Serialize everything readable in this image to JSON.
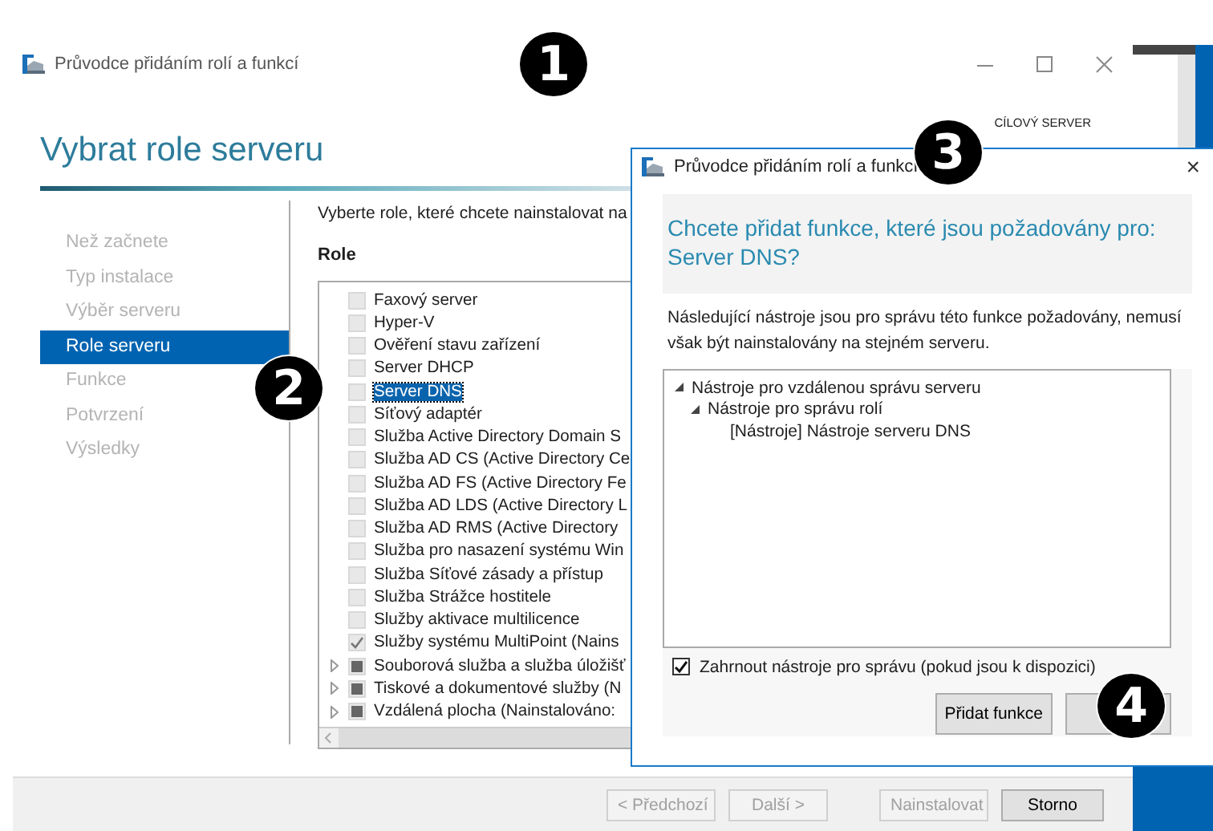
{
  "main_window": {
    "title": "Průvodce přidáním rolí a funkcí",
    "heading": "Vybrat role serveru",
    "target_label": "CÍLOVÝ SERVER",
    "sidebar": [
      {
        "label": "Než začnete",
        "selected": false
      },
      {
        "label": "Typ instalace",
        "selected": false
      },
      {
        "label": "Výběr serveru",
        "selected": false
      },
      {
        "label": "Role serveru",
        "selected": true
      },
      {
        "label": "Funkce",
        "selected": false
      },
      {
        "label": "Potvrzení",
        "selected": false
      },
      {
        "label": "Výsledky",
        "selected": false
      }
    ],
    "instruction": "Vyberte role, které chcete nainstalovat na",
    "roles_label": "Role",
    "roles": [
      {
        "label": "Faxový server",
        "checked": false,
        "partial": false,
        "expandable": false,
        "selected": false
      },
      {
        "label": "Hyper-V",
        "checked": false,
        "partial": false,
        "expandable": false,
        "selected": false
      },
      {
        "label": "Ověření stavu zařízení",
        "checked": false,
        "partial": false,
        "expandable": false,
        "selected": false
      },
      {
        "label": "Server DHCP",
        "checked": false,
        "partial": false,
        "expandable": false,
        "selected": false
      },
      {
        "label": "Server DNS",
        "checked": false,
        "partial": false,
        "expandable": false,
        "selected": true
      },
      {
        "label": "Síťový adaptér",
        "checked": false,
        "partial": false,
        "expandable": false,
        "selected": false
      },
      {
        "label": "Služba Active Directory Domain S",
        "checked": false,
        "partial": false,
        "expandable": false,
        "selected": false
      },
      {
        "label": "Služba AD CS (Active Directory Ce",
        "checked": false,
        "partial": false,
        "expandable": false,
        "selected": false
      },
      {
        "label": "Služba AD FS (Active Directory Fe",
        "checked": false,
        "partial": false,
        "expandable": false,
        "selected": false
      },
      {
        "label": "Služba AD LDS (Active Directory L",
        "checked": false,
        "partial": false,
        "expandable": false,
        "selected": false
      },
      {
        "label": "Služba AD RMS (Active Directory",
        "checked": false,
        "partial": false,
        "expandable": false,
        "selected": false
      },
      {
        "label": "Služba pro nasazení systému Win",
        "checked": false,
        "partial": false,
        "expandable": false,
        "selected": false
      },
      {
        "label": "Služba Síťové zásady a přístup",
        "checked": false,
        "partial": false,
        "expandable": false,
        "selected": false
      },
      {
        "label": "Služba Strážce hostitele",
        "checked": false,
        "partial": false,
        "expandable": false,
        "selected": false
      },
      {
        "label": "Služby aktivace multilicence",
        "checked": false,
        "partial": false,
        "expandable": false,
        "selected": false
      },
      {
        "label": "Služby systému MultiPoint (Nains",
        "checked": true,
        "partial": false,
        "expandable": false,
        "selected": false
      },
      {
        "label": "Souborová služba a služba úložišť",
        "checked": false,
        "partial": true,
        "expandable": true,
        "selected": false
      },
      {
        "label": "Tiskové a dokumentové služby (N",
        "checked": false,
        "partial": true,
        "expandable": true,
        "selected": false
      },
      {
        "label": "Vzdálená plocha (Nainstalováno:",
        "checked": false,
        "partial": true,
        "expandable": true,
        "selected": false
      }
    ],
    "footer_buttons": [
      {
        "label": "< Předchozí",
        "disabled": true
      },
      {
        "label": "Další >",
        "disabled": true
      },
      {
        "label": "Nainstalovat",
        "disabled": true
      },
      {
        "label": "Storno",
        "disabled": false
      }
    ]
  },
  "dialog": {
    "title": "Průvodce přidáním rolí a funkcí",
    "close": "×",
    "question": "Chcete přidat funkce, které jsou požadovány pro: Server DNS?",
    "description": "Následující nástroje jsou pro správu této funkce požadovány, nemusí však být nainstalovány na stejném serveru.",
    "tree": [
      {
        "label": "Nástroje pro vzdálenou správu serveru",
        "expanded": true,
        "children": [
          {
            "label": "Nástroje pro správu rolí",
            "expanded": true,
            "children": [
              {
                "label": "[Nástroje] Nástroje serveru DNS"
              }
            ]
          }
        ]
      }
    ],
    "include_tools": {
      "label": "Zahrnout nástroje pro správu (pokud jsou k dispozici)",
      "checked": true
    },
    "buttons": [
      {
        "label": "Přidat funkce"
      }
    ]
  },
  "annotations": [
    "1",
    "2",
    "3",
    "4"
  ]
}
